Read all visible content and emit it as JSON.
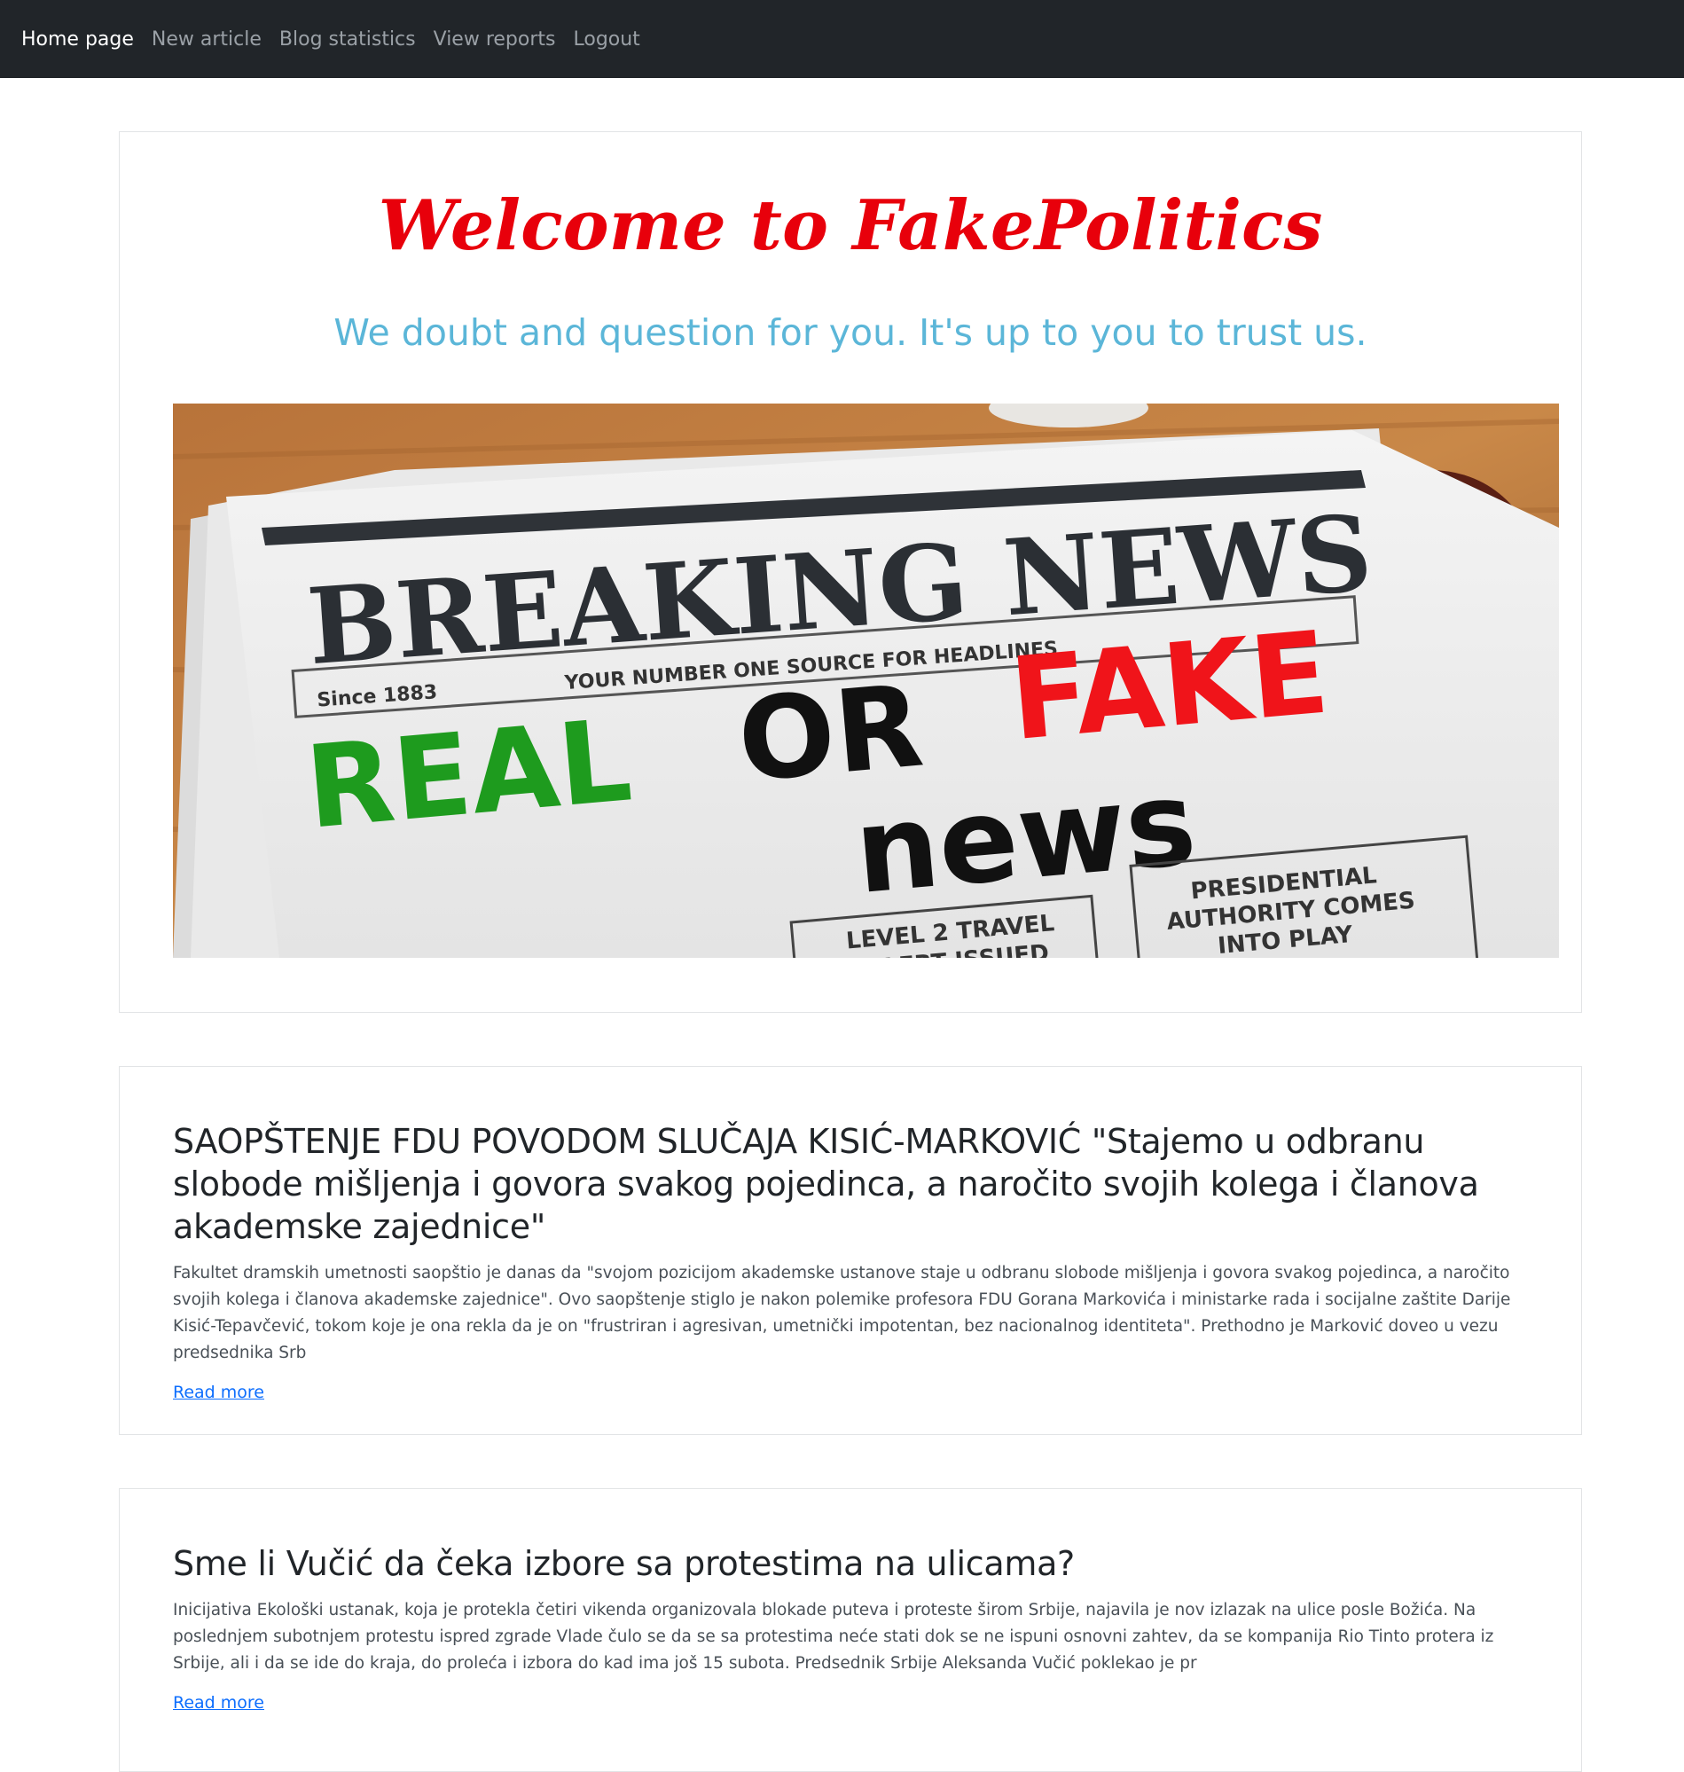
{
  "navbar": {
    "items": [
      {
        "label": "Home page",
        "active": true
      },
      {
        "label": "New article"
      },
      {
        "label": "Blog statistics"
      },
      {
        "label": "View reports"
      },
      {
        "label": "Logout"
      }
    ]
  },
  "hero": {
    "welcome": "Welcome to ",
    "brand": "FakePolitics",
    "tagline": "We doubt and question for you. It's up to you to trust us.",
    "image": {
      "headline": "BREAKING NEWS",
      "since": "Since 1883",
      "subline": "YOUR NUMBER ONE SOURCE FOR HEADLINES",
      "real": "REAL",
      "or": "OR",
      "fake": "FAKE",
      "news": "news",
      "box1": "LEVEL 2 TRAVEL",
      "box1b": "ALERT ISSUED",
      "box2a": "PRESIDENTIAL",
      "box2b": "AUTHORITY COMES",
      "box2c": "INTO PLAY"
    }
  },
  "articles": [
    {
      "title": "SAOPŠTENJE FDU POVODOM SLUČAJA KISIĆ-MARKOVIĆ \"Stajemo u odbranu slobode mišljenja i govora svakog pojedinca, a naročito svojih kolega i članova akademske zajednice\"",
      "excerpt": "Fakultet dramskih umetnosti saopštio je danas da \"svojom pozicijom akademske ustanove staje u odbranu slobode mišljenja i govora svakog pojedinca, a naročito svojih kolega i članova akademske zajednice\". Ovo saopštenje stiglo je nakon polemike profesora FDU Gorana Markovića i ministarke rada i socijalne zaštite Darije Kisić-Tepavčević, tokom koje je ona rekla da je on \"frustriran i agresivan, umetnički impotentan, bez nacionalnog identiteta\". Prethodno je Marković doveo u vezu predsednika Srb",
      "read_more": "Read more"
    },
    {
      "title": "Sme li Vučić da čeka izbore sa protestima na ulicama?",
      "excerpt": "Inicijativa Ekološki ustanak, koja je protekla četiri vikenda organizovala blokade puteva i proteste širom Srbije, najavila je nov izlazak na ulice posle Božića. Na poslednjem subotnjem protestu ispred zgrade Vlade čulo se da se sa protestima neće stati dok se ne ispuni osnovni zahtev, da se kompanija Rio Tinto protera iz Srbije, ali i da se ide do kraja, do proleća i izbora do kad ima još 15 subota. Predsednik Srbije Aleksanda Vučić poklekao je pr",
      "read_more": "Read more"
    }
  ]
}
